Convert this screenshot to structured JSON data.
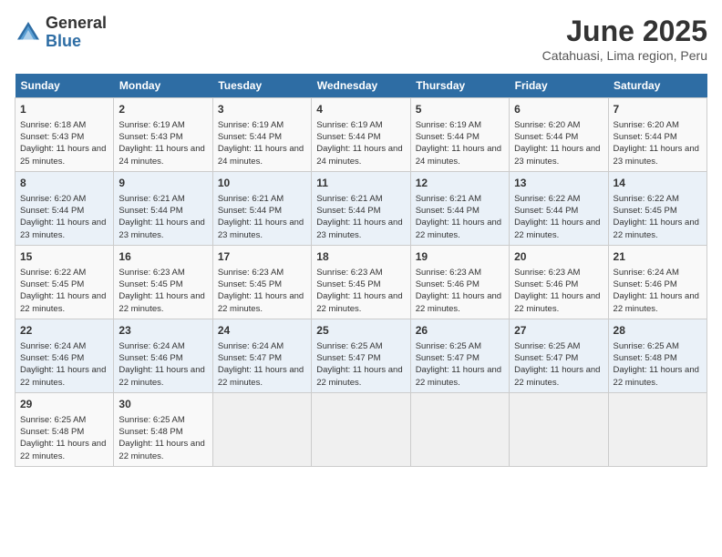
{
  "header": {
    "logo_general": "General",
    "logo_blue": "Blue",
    "month_title": "June 2025",
    "subtitle": "Catahuasi, Lima region, Peru"
  },
  "days_of_week": [
    "Sunday",
    "Monday",
    "Tuesday",
    "Wednesday",
    "Thursday",
    "Friday",
    "Saturday"
  ],
  "weeks": [
    [
      {
        "day": "1",
        "info": "Sunrise: 6:18 AM\nSunset: 5:43 PM\nDaylight: 11 hours and 25 minutes."
      },
      {
        "day": "2",
        "info": "Sunrise: 6:19 AM\nSunset: 5:43 PM\nDaylight: 11 hours and 24 minutes."
      },
      {
        "day": "3",
        "info": "Sunrise: 6:19 AM\nSunset: 5:44 PM\nDaylight: 11 hours and 24 minutes."
      },
      {
        "day": "4",
        "info": "Sunrise: 6:19 AM\nSunset: 5:44 PM\nDaylight: 11 hours and 24 minutes."
      },
      {
        "day": "5",
        "info": "Sunrise: 6:19 AM\nSunset: 5:44 PM\nDaylight: 11 hours and 24 minutes."
      },
      {
        "day": "6",
        "info": "Sunrise: 6:20 AM\nSunset: 5:44 PM\nDaylight: 11 hours and 23 minutes."
      },
      {
        "day": "7",
        "info": "Sunrise: 6:20 AM\nSunset: 5:44 PM\nDaylight: 11 hours and 23 minutes."
      }
    ],
    [
      {
        "day": "8",
        "info": "Sunrise: 6:20 AM\nSunset: 5:44 PM\nDaylight: 11 hours and 23 minutes."
      },
      {
        "day": "9",
        "info": "Sunrise: 6:21 AM\nSunset: 5:44 PM\nDaylight: 11 hours and 23 minutes."
      },
      {
        "day": "10",
        "info": "Sunrise: 6:21 AM\nSunset: 5:44 PM\nDaylight: 11 hours and 23 minutes."
      },
      {
        "day": "11",
        "info": "Sunrise: 6:21 AM\nSunset: 5:44 PM\nDaylight: 11 hours and 23 minutes."
      },
      {
        "day": "12",
        "info": "Sunrise: 6:21 AM\nSunset: 5:44 PM\nDaylight: 11 hours and 22 minutes."
      },
      {
        "day": "13",
        "info": "Sunrise: 6:22 AM\nSunset: 5:44 PM\nDaylight: 11 hours and 22 minutes."
      },
      {
        "day": "14",
        "info": "Sunrise: 6:22 AM\nSunset: 5:45 PM\nDaylight: 11 hours and 22 minutes."
      }
    ],
    [
      {
        "day": "15",
        "info": "Sunrise: 6:22 AM\nSunset: 5:45 PM\nDaylight: 11 hours and 22 minutes."
      },
      {
        "day": "16",
        "info": "Sunrise: 6:23 AM\nSunset: 5:45 PM\nDaylight: 11 hours and 22 minutes."
      },
      {
        "day": "17",
        "info": "Sunrise: 6:23 AM\nSunset: 5:45 PM\nDaylight: 11 hours and 22 minutes."
      },
      {
        "day": "18",
        "info": "Sunrise: 6:23 AM\nSunset: 5:45 PM\nDaylight: 11 hours and 22 minutes."
      },
      {
        "day": "19",
        "info": "Sunrise: 6:23 AM\nSunset: 5:46 PM\nDaylight: 11 hours and 22 minutes."
      },
      {
        "day": "20",
        "info": "Sunrise: 6:23 AM\nSunset: 5:46 PM\nDaylight: 11 hours and 22 minutes."
      },
      {
        "day": "21",
        "info": "Sunrise: 6:24 AM\nSunset: 5:46 PM\nDaylight: 11 hours and 22 minutes."
      }
    ],
    [
      {
        "day": "22",
        "info": "Sunrise: 6:24 AM\nSunset: 5:46 PM\nDaylight: 11 hours and 22 minutes."
      },
      {
        "day": "23",
        "info": "Sunrise: 6:24 AM\nSunset: 5:46 PM\nDaylight: 11 hours and 22 minutes."
      },
      {
        "day": "24",
        "info": "Sunrise: 6:24 AM\nSunset: 5:47 PM\nDaylight: 11 hours and 22 minutes."
      },
      {
        "day": "25",
        "info": "Sunrise: 6:25 AM\nSunset: 5:47 PM\nDaylight: 11 hours and 22 minutes."
      },
      {
        "day": "26",
        "info": "Sunrise: 6:25 AM\nSunset: 5:47 PM\nDaylight: 11 hours and 22 minutes."
      },
      {
        "day": "27",
        "info": "Sunrise: 6:25 AM\nSunset: 5:47 PM\nDaylight: 11 hours and 22 minutes."
      },
      {
        "day": "28",
        "info": "Sunrise: 6:25 AM\nSunset: 5:48 PM\nDaylight: 11 hours and 22 minutes."
      }
    ],
    [
      {
        "day": "29",
        "info": "Sunrise: 6:25 AM\nSunset: 5:48 PM\nDaylight: 11 hours and 22 minutes."
      },
      {
        "day": "30",
        "info": "Sunrise: 6:25 AM\nSunset: 5:48 PM\nDaylight: 11 hours and 22 minutes."
      },
      {
        "day": "",
        "info": ""
      },
      {
        "day": "",
        "info": ""
      },
      {
        "day": "",
        "info": ""
      },
      {
        "day": "",
        "info": ""
      },
      {
        "day": "",
        "info": ""
      }
    ]
  ]
}
